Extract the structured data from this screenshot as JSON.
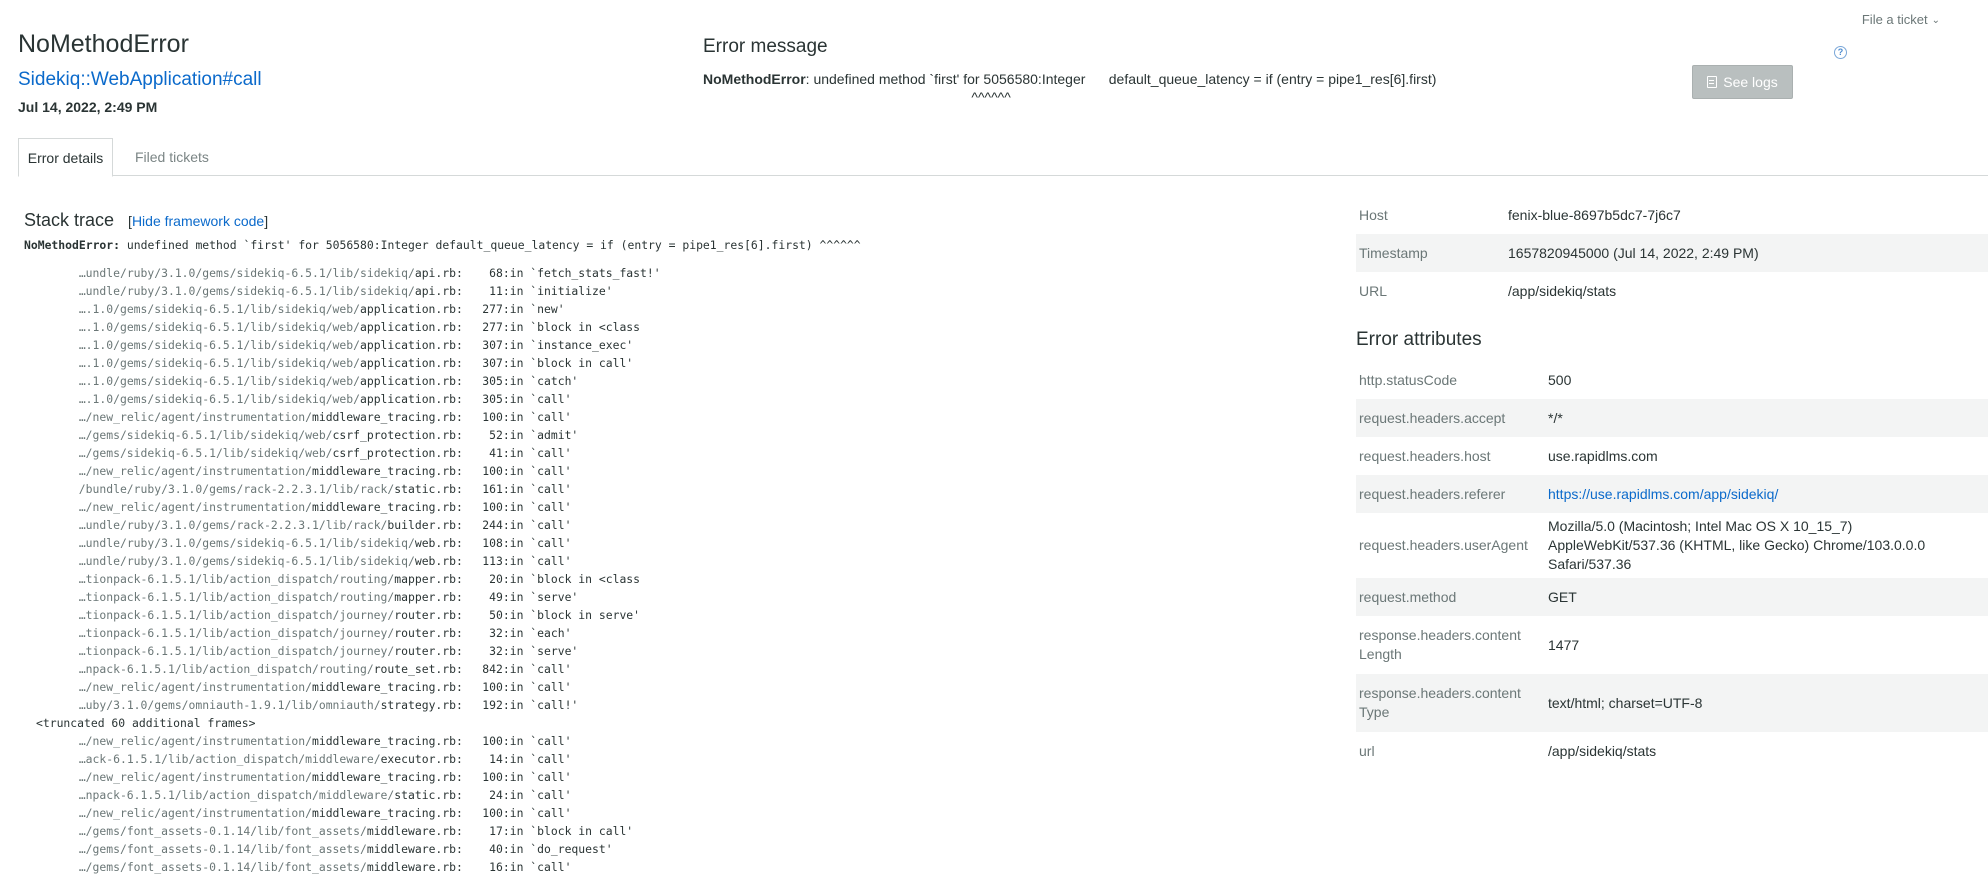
{
  "header": {
    "file_ticket": "File a ticket",
    "error_class": "NoMethodError",
    "transaction": "Sidekiq::WebApplication#call",
    "date": "Jul 14, 2022, 2:49 PM",
    "message_title": "Error message",
    "message_class": "NoMethodError",
    "message_text": ": undefined method `first' for 5056580:Integer      default_queue_latency = if (entry = pipe1_res[6].first)\n                                                                     ^^^^^^",
    "see_logs": "See logs",
    "help": "?"
  },
  "tabs": [
    {
      "label": "Error details"
    },
    {
      "label": "Filed tickets"
    }
  ],
  "stack": {
    "title": "Stack trace",
    "hide_prefix": "[",
    "hide_link": "Hide framework code",
    "hide_suffix": "]",
    "error_class": "NoMethodError:",
    "error_text": " undefined method `first' for 5056580:Integer default_queue_latency = if (entry = pipe1_res[6].first) ^^^^^^",
    "frames": [
      {
        "dir": "…undle/ruby/3.1.0/gems/sidekiq-6.5.1/lib/sidekiq/",
        "file": "api.rb",
        "line": "68",
        "method": "in `fetch_stats_fast!'"
      },
      {
        "dir": "…undle/ruby/3.1.0/gems/sidekiq-6.5.1/lib/sidekiq/",
        "file": "api.rb",
        "line": "11",
        "method": "in `initialize'"
      },
      {
        "dir": "….1.0/gems/sidekiq-6.5.1/lib/sidekiq/web/",
        "file": "application.rb",
        "line": "277",
        "method": "in `new'"
      },
      {
        "dir": "….1.0/gems/sidekiq-6.5.1/lib/sidekiq/web/",
        "file": "application.rb",
        "line": "277",
        "method": "in `block in <class"
      },
      {
        "dir": "….1.0/gems/sidekiq-6.5.1/lib/sidekiq/web/",
        "file": "application.rb",
        "line": "307",
        "method": "in `instance_exec'"
      },
      {
        "dir": "….1.0/gems/sidekiq-6.5.1/lib/sidekiq/web/",
        "file": "application.rb",
        "line": "307",
        "method": "in `block in call'"
      },
      {
        "dir": "….1.0/gems/sidekiq-6.5.1/lib/sidekiq/web/",
        "file": "application.rb",
        "line": "305",
        "method": "in `catch'"
      },
      {
        "dir": "….1.0/gems/sidekiq-6.5.1/lib/sidekiq/web/",
        "file": "application.rb",
        "line": "305",
        "method": "in `call'"
      },
      {
        "dir": "…/new_relic/agent/instrumentation/",
        "file": "middleware_tracing.rb",
        "line": "100",
        "method": "in `call'"
      },
      {
        "dir": "…/gems/sidekiq-6.5.1/lib/sidekiq/web/",
        "file": "csrf_protection.rb",
        "line": "52",
        "method": "in `admit'"
      },
      {
        "dir": "…/gems/sidekiq-6.5.1/lib/sidekiq/web/",
        "file": "csrf_protection.rb",
        "line": "41",
        "method": "in `call'"
      },
      {
        "dir": "…/new_relic/agent/instrumentation/",
        "file": "middleware_tracing.rb",
        "line": "100",
        "method": "in `call'"
      },
      {
        "dir": "/bundle/ruby/3.1.0/gems/rack-2.2.3.1/lib/rack/",
        "file": "static.rb",
        "line": "161",
        "method": "in `call'"
      },
      {
        "dir": "…/new_relic/agent/instrumentation/",
        "file": "middleware_tracing.rb",
        "line": "100",
        "method": "in `call'"
      },
      {
        "dir": "…undle/ruby/3.1.0/gems/rack-2.2.3.1/lib/rack/",
        "file": "builder.rb",
        "line": "244",
        "method": "in `call'"
      },
      {
        "dir": "…undle/ruby/3.1.0/gems/sidekiq-6.5.1/lib/sidekiq/",
        "file": "web.rb",
        "line": "108",
        "method": "in `call'"
      },
      {
        "dir": "…undle/ruby/3.1.0/gems/sidekiq-6.5.1/lib/sidekiq/",
        "file": "web.rb",
        "line": "113",
        "method": "in `call'"
      },
      {
        "dir": "…tionpack-6.1.5.1/lib/action_dispatch/routing/",
        "file": "mapper.rb",
        "line": "20",
        "method": "in `block in <class"
      },
      {
        "dir": "…tionpack-6.1.5.1/lib/action_dispatch/routing/",
        "file": "mapper.rb",
        "line": "49",
        "method": "in `serve'"
      },
      {
        "dir": "…tionpack-6.1.5.1/lib/action_dispatch/journey/",
        "file": "router.rb",
        "line": "50",
        "method": "in `block in serve'"
      },
      {
        "dir": "…tionpack-6.1.5.1/lib/action_dispatch/journey/",
        "file": "router.rb",
        "line": "32",
        "method": "in `each'"
      },
      {
        "dir": "…tionpack-6.1.5.1/lib/action_dispatch/journey/",
        "file": "router.rb",
        "line": "32",
        "method": "in `serve'"
      },
      {
        "dir": "…npack-6.1.5.1/lib/action_dispatch/routing/",
        "file": "route_set.rb",
        "line": "842",
        "method": "in `call'"
      },
      {
        "dir": "…/new_relic/agent/instrumentation/",
        "file": "middleware_tracing.rb",
        "line": "100",
        "method": "in `call'"
      },
      {
        "dir": "…uby/3.1.0/gems/omniauth-1.9.1/lib/omniauth/",
        "file": "strategy.rb",
        "line": "192",
        "method": "in `call!'"
      }
    ],
    "truncated": "<truncated 60 additional frames>",
    "frames_after": [
      {
        "dir": "…/new_relic/agent/instrumentation/",
        "file": "middleware_tracing.rb",
        "line": "100",
        "method": "in `call'"
      },
      {
        "dir": "…ack-6.1.5.1/lib/action_dispatch/middleware/",
        "file": "executor.rb",
        "line": "14",
        "method": "in `call'"
      },
      {
        "dir": "…/new_relic/agent/instrumentation/",
        "file": "middleware_tracing.rb",
        "line": "100",
        "method": "in `call'"
      },
      {
        "dir": "…npack-6.1.5.1/lib/action_dispatch/middleware/",
        "file": "static.rb",
        "line": "24",
        "method": "in `call'"
      },
      {
        "dir": "…/new_relic/agent/instrumentation/",
        "file": "middleware_tracing.rb",
        "line": "100",
        "method": "in `call'"
      },
      {
        "dir": "…/gems/font_assets-0.1.14/lib/font_assets/",
        "file": "middleware.rb",
        "line": "17",
        "method": "in `block in call'"
      },
      {
        "dir": "…/gems/font_assets-0.1.14/lib/font_assets/",
        "file": "middleware.rb",
        "line": "40",
        "method": "in `do_request'"
      },
      {
        "dir": "…/gems/font_assets-0.1.14/lib/font_assets/",
        "file": "middleware.rb",
        "line": "16",
        "method": "in `call'"
      }
    ]
  },
  "info": {
    "rows": [
      {
        "key": "Host",
        "value": "fenix-blue-8697b5dc7-7j6c7"
      },
      {
        "key": "Timestamp",
        "value": "1657820945000 (Jul 14, 2022, 2:49 PM)"
      },
      {
        "key": "URL",
        "value": "/app/sidekiq/stats"
      }
    ]
  },
  "attributes": {
    "title": "Error attributes",
    "rows": [
      {
        "key": "http.statusCode",
        "value": "500"
      },
      {
        "key": "request.headers.accept",
        "value": "*/*"
      },
      {
        "key": "request.headers.host",
        "value": "use.rapidlms.com"
      },
      {
        "key": "request.headers.referer",
        "value": "https://use.rapidlms.com/app/sidekiq/",
        "link": true
      },
      {
        "key": "request.headers.userAgent",
        "value": "Mozilla/5.0 (Macintosh; Intel Mac OS X 10_15_7) AppleWebKit/537.36 (KHTML, like Gecko) Chrome/103.0.0.0 Safari/537.36"
      },
      {
        "key": "request.method",
        "value": "GET"
      },
      {
        "key": "response.headers.contentLength",
        "value": "1477"
      },
      {
        "key": "response.headers.contentType",
        "value": "text/html; charset=UTF-8"
      },
      {
        "key": "url",
        "value": "/app/sidekiq/stats"
      }
    ]
  },
  "colors": {
    "link": "#0b6acb",
    "text": "#2a3434",
    "muted": "#6b7777",
    "button_disabled": "#b9bfbf",
    "row_alt": "#f3f4f4"
  }
}
